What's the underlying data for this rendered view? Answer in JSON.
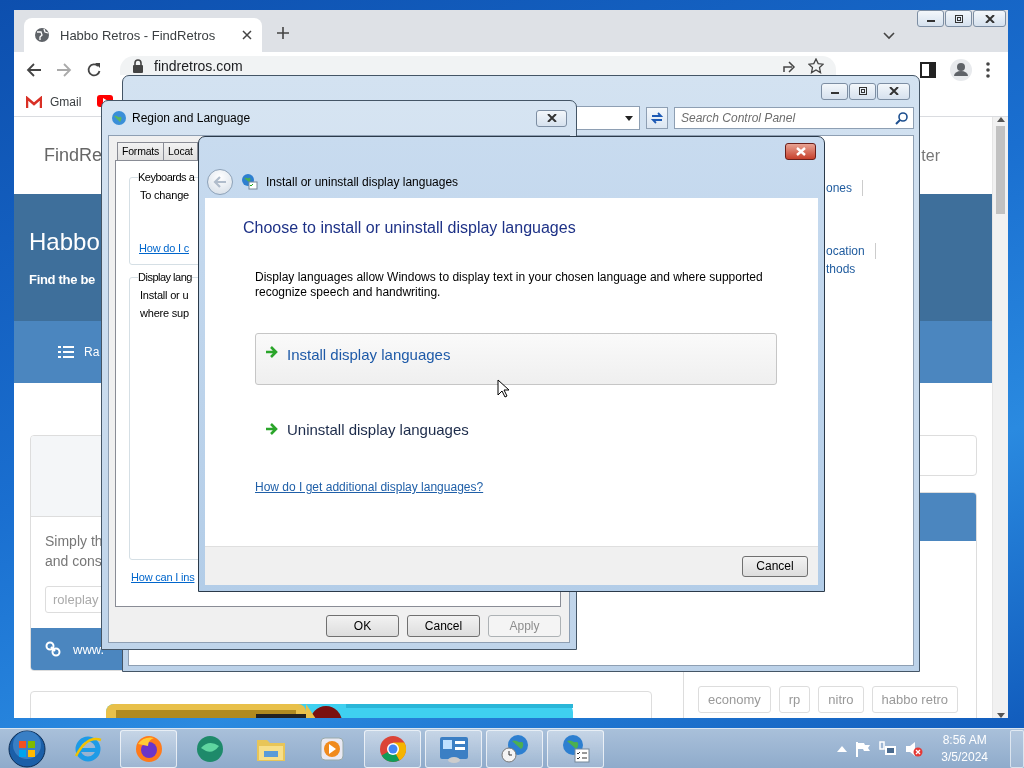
{
  "browser": {
    "tab": {
      "title": "Habbo Retros - FindRetros",
      "selected": true
    },
    "address": "findretros.com",
    "bookmarks": [
      {
        "label": "Gmail"
      }
    ],
    "page": {
      "logo": "FindRe",
      "header_link": "ter",
      "hero_title": "Habbo",
      "hero_subtitle": "Find the be",
      "nav_item": "Ra",
      "card_lines": [
        "Simply th",
        "and cons"
      ],
      "tag_field": {
        "placeholder": "roleplay"
      },
      "card_link": "www.",
      "tags": [
        "economy",
        "rp",
        "nitro",
        "habbo retro"
      ]
    }
  },
  "control_panel": {
    "search": {
      "placeholder": "Search Control Panel"
    },
    "links": [
      {
        "label": "ones",
        "separator": true
      },
      {
        "label": "ocation",
        "separator": true
      },
      {
        "label": "thods",
        "separator": false
      }
    ]
  },
  "region_dialog": {
    "title": "Region and Language",
    "tabs": [
      {
        "label": "Formats",
        "selected": false
      },
      {
        "label": "Locat",
        "selected": false
      }
    ],
    "groups": [
      {
        "title": "Keyboards a",
        "lines": [
          "To change"
        ],
        "link": "How do I c"
      },
      {
        "title": "Display lang",
        "lines": [
          "Install or u",
          "where sup"
        ]
      }
    ],
    "link": "How can I ins",
    "buttons": [
      {
        "label": "OK",
        "disabled": false
      },
      {
        "label": "Cancel",
        "disabled": false
      },
      {
        "label": "Apply",
        "disabled": true
      }
    ]
  },
  "install_dialog": {
    "title": "Install or uninstall display languages",
    "heading": "Choose to install or uninstall display languages",
    "description": "Display languages allow Windows to display text in your chosen language and where supported recognize speech and handwriting.",
    "options": [
      {
        "label": "Install display languages",
        "hovered": true
      },
      {
        "label": "Uninstall display languages",
        "hovered": false
      }
    ],
    "help_link": "How do I get additional display languages?",
    "buttons": [
      {
        "label": "Cancel"
      }
    ]
  },
  "taskbar": {
    "apps": [
      {
        "kind": "ie",
        "active": false
      },
      {
        "kind": "firefox",
        "active": true
      },
      {
        "kind": "round",
        "active": false
      },
      {
        "kind": "folder",
        "active": false
      },
      {
        "kind": "media",
        "active": false
      },
      {
        "kind": "chrome",
        "active": true
      },
      {
        "kind": "control-panel",
        "active": true
      },
      {
        "kind": "clock-globe",
        "active": true
      },
      {
        "kind": "globe-list",
        "active": true
      }
    ],
    "clock": {
      "time": "8:56 AM",
      "date": "3/5/2024"
    }
  }
}
